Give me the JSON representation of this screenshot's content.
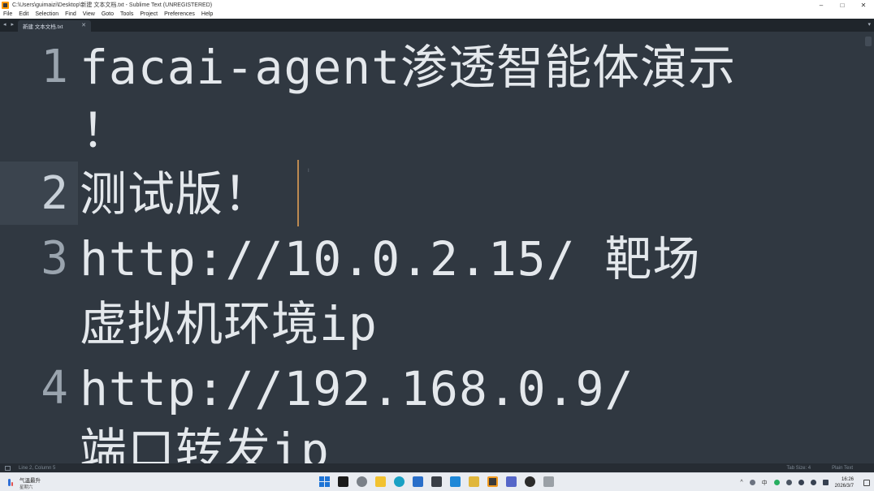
{
  "window": {
    "title": "C:\\Users\\guimaizi\\Desktop\\新建 文本文档.txt - Sublime Text (UNREGISTERED)",
    "minimize": "–",
    "maximize": "□",
    "close": "✕"
  },
  "menu": {
    "items": [
      "File",
      "Edit",
      "Selection",
      "Find",
      "View",
      "Goto",
      "Tools",
      "Project",
      "Preferences",
      "Help"
    ]
  },
  "tabs": {
    "nav": "◂ ▸",
    "active_label": "新建 文本文档.txt",
    "close": "✕",
    "dropdown": "▾"
  },
  "editor": {
    "lines": [
      {
        "number": "1",
        "rows": [
          "facai-agent渗透智能体演示",
          "！"
        ]
      },
      {
        "number": "2",
        "rows": [
          "测试版！"
        ]
      },
      {
        "number": "3",
        "rows": [
          "http://10.0.2.15/ 靶场",
          "虚拟机环境ip"
        ]
      },
      {
        "number": "4",
        "rows": [
          "http://192.168.0.9/",
          "端口转发ip"
        ]
      }
    ],
    "minimap_mark": "I"
  },
  "status": {
    "position": "Line 2, Column 5",
    "tab_size": "Tab Size: 4",
    "syntax": "Plain Text"
  },
  "taskbar": {
    "weather_line1": "气温最升",
    "weather_line2": "星期六",
    "tray_arrow": "^",
    "ime": "中",
    "time": "16:26",
    "date": "2026/3/7"
  },
  "colors": {
    "editor_bg": "#303841",
    "caret": "#f9ae58",
    "accent_blue": "#1e74d6"
  }
}
